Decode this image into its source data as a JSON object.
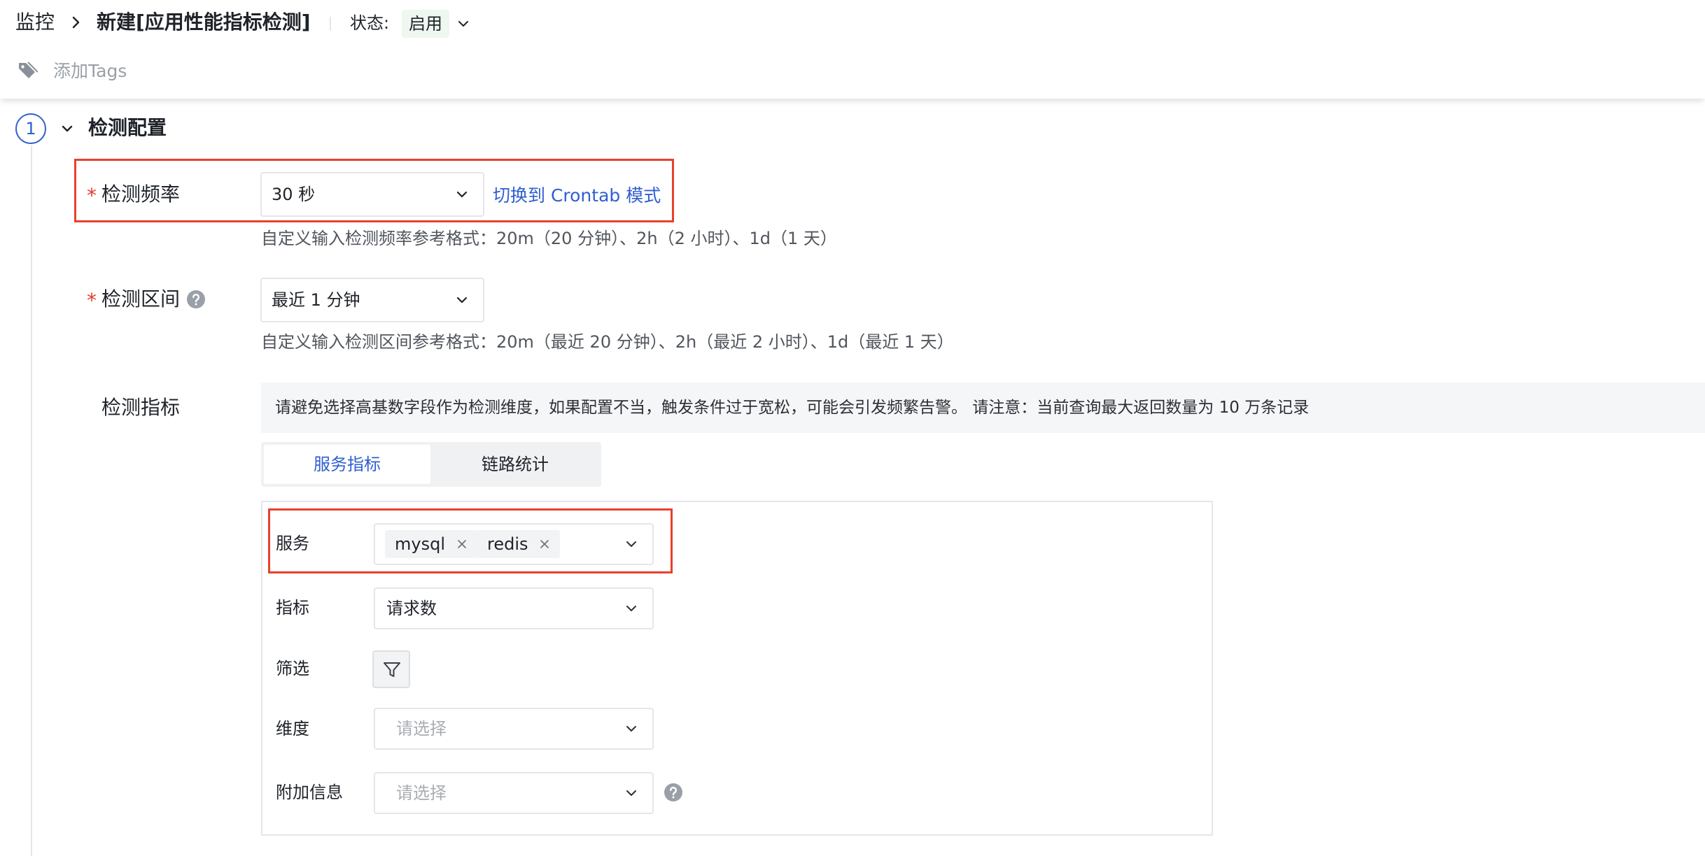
{
  "header": {
    "breadcrumb_root": "监控",
    "title": "新建[应用性能指标检测]",
    "status_label": "状态:",
    "status_value": "启用",
    "tags_placeholder": "添加Tags"
  },
  "section": {
    "step_number": "1",
    "title": "检测配置"
  },
  "frequency": {
    "required_mark": "*",
    "label": "检测频率",
    "value": "30 秒",
    "switch_link": "切换到 Crontab 模式",
    "hint": "自定义输入检测频率参考格式：20m（20 分钟）、2h（2 小时）、1d（1 天）"
  },
  "range": {
    "required_mark": "*",
    "label": "检测区间",
    "value": "最近 1 分钟",
    "hint": "自定义输入检测区间参考格式：20m（最近 20 分钟）、2h（最近 2 小时）、1d（最近 1 天）"
  },
  "metrics": {
    "label": "检测指标",
    "notice": "请避免选择高基数字段作为检测维度，如果配置不当，触发条件过于宽松，可能会引发频繁告警。 请注意：当前查询最大返回数量为 10 万条记录",
    "tabs": [
      {
        "label": "服务指标",
        "active": true
      },
      {
        "label": "链路统计",
        "active": false
      }
    ],
    "service": {
      "label": "服务",
      "selected": [
        "mysql",
        "redis"
      ]
    },
    "indicator": {
      "label": "指标",
      "value": "请求数"
    },
    "filter": {
      "label": "筛选"
    },
    "dimension": {
      "label": "维度",
      "placeholder": "请选择"
    },
    "extra_info": {
      "label": "附加信息",
      "placeholder": "请选择"
    }
  },
  "colors": {
    "accent": "#2f5fd0",
    "required": "#e03c2e",
    "highlight_border": "#e8412c",
    "status_badge_bg": "#eef7f0"
  },
  "icons": {
    "breadcrumb_separator": "chevron-right-icon",
    "status_dropdown": "chevron-down-icon",
    "tags": "tag-icon",
    "section_toggle": "chevron-down-icon",
    "help": "question-circle-icon",
    "filter": "funnel-icon",
    "chip_remove": "close-icon"
  }
}
